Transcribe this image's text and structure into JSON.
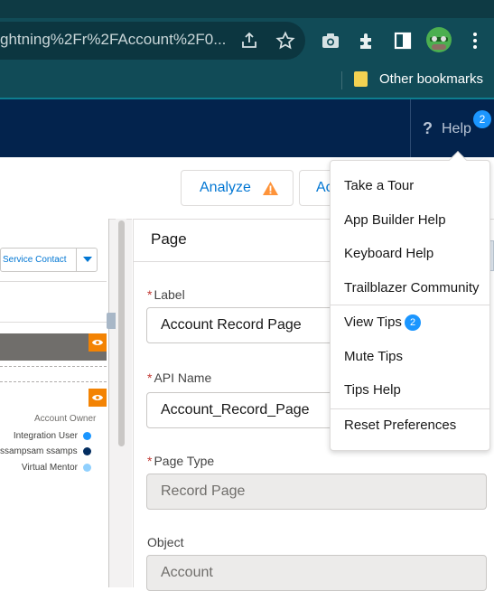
{
  "browser": {
    "url_fragment": "ghtning%2Fr%2FAccount%2F0...",
    "bookmarks": {
      "other_label": "Other bookmarks"
    }
  },
  "header": {
    "help_label": "Help",
    "help_badge": "2"
  },
  "toolbar": {
    "analyze_label": "Analyze",
    "activation_label_partial": "Ac"
  },
  "canvas": {
    "service_contact": "Service Contact",
    "legend_title": "Account Owner",
    "legend": [
      {
        "label": "Integration User",
        "color": "#1b96ff"
      },
      {
        "label": "ssampsam ssampsam",
        "color": "#032d60"
      },
      {
        "label": "Virtual Mentor",
        "color": "#90d0fe"
      }
    ]
  },
  "panel": {
    "title": "Page",
    "label_caption": "Label",
    "label_value": "Account Record Page",
    "api_caption": "API Name",
    "api_value": "Account_Record_Page",
    "page_type_caption": "Page Type",
    "page_type_value": "Record Page",
    "object_caption": "Object",
    "object_value": "Account"
  },
  "help_menu": {
    "items": [
      "Take a Tour",
      "App Builder Help",
      "Keyboard Help",
      "Trailblazer Community",
      "View Tips",
      "Mute Tips",
      "Tips Help",
      "Reset Preferences"
    ],
    "tips_badge": "2"
  },
  "colors": {
    "brand_header": "#03234d",
    "link_blue": "#0176d3",
    "badge_blue": "#1b96ff",
    "warning_orange": "#f38303"
  }
}
